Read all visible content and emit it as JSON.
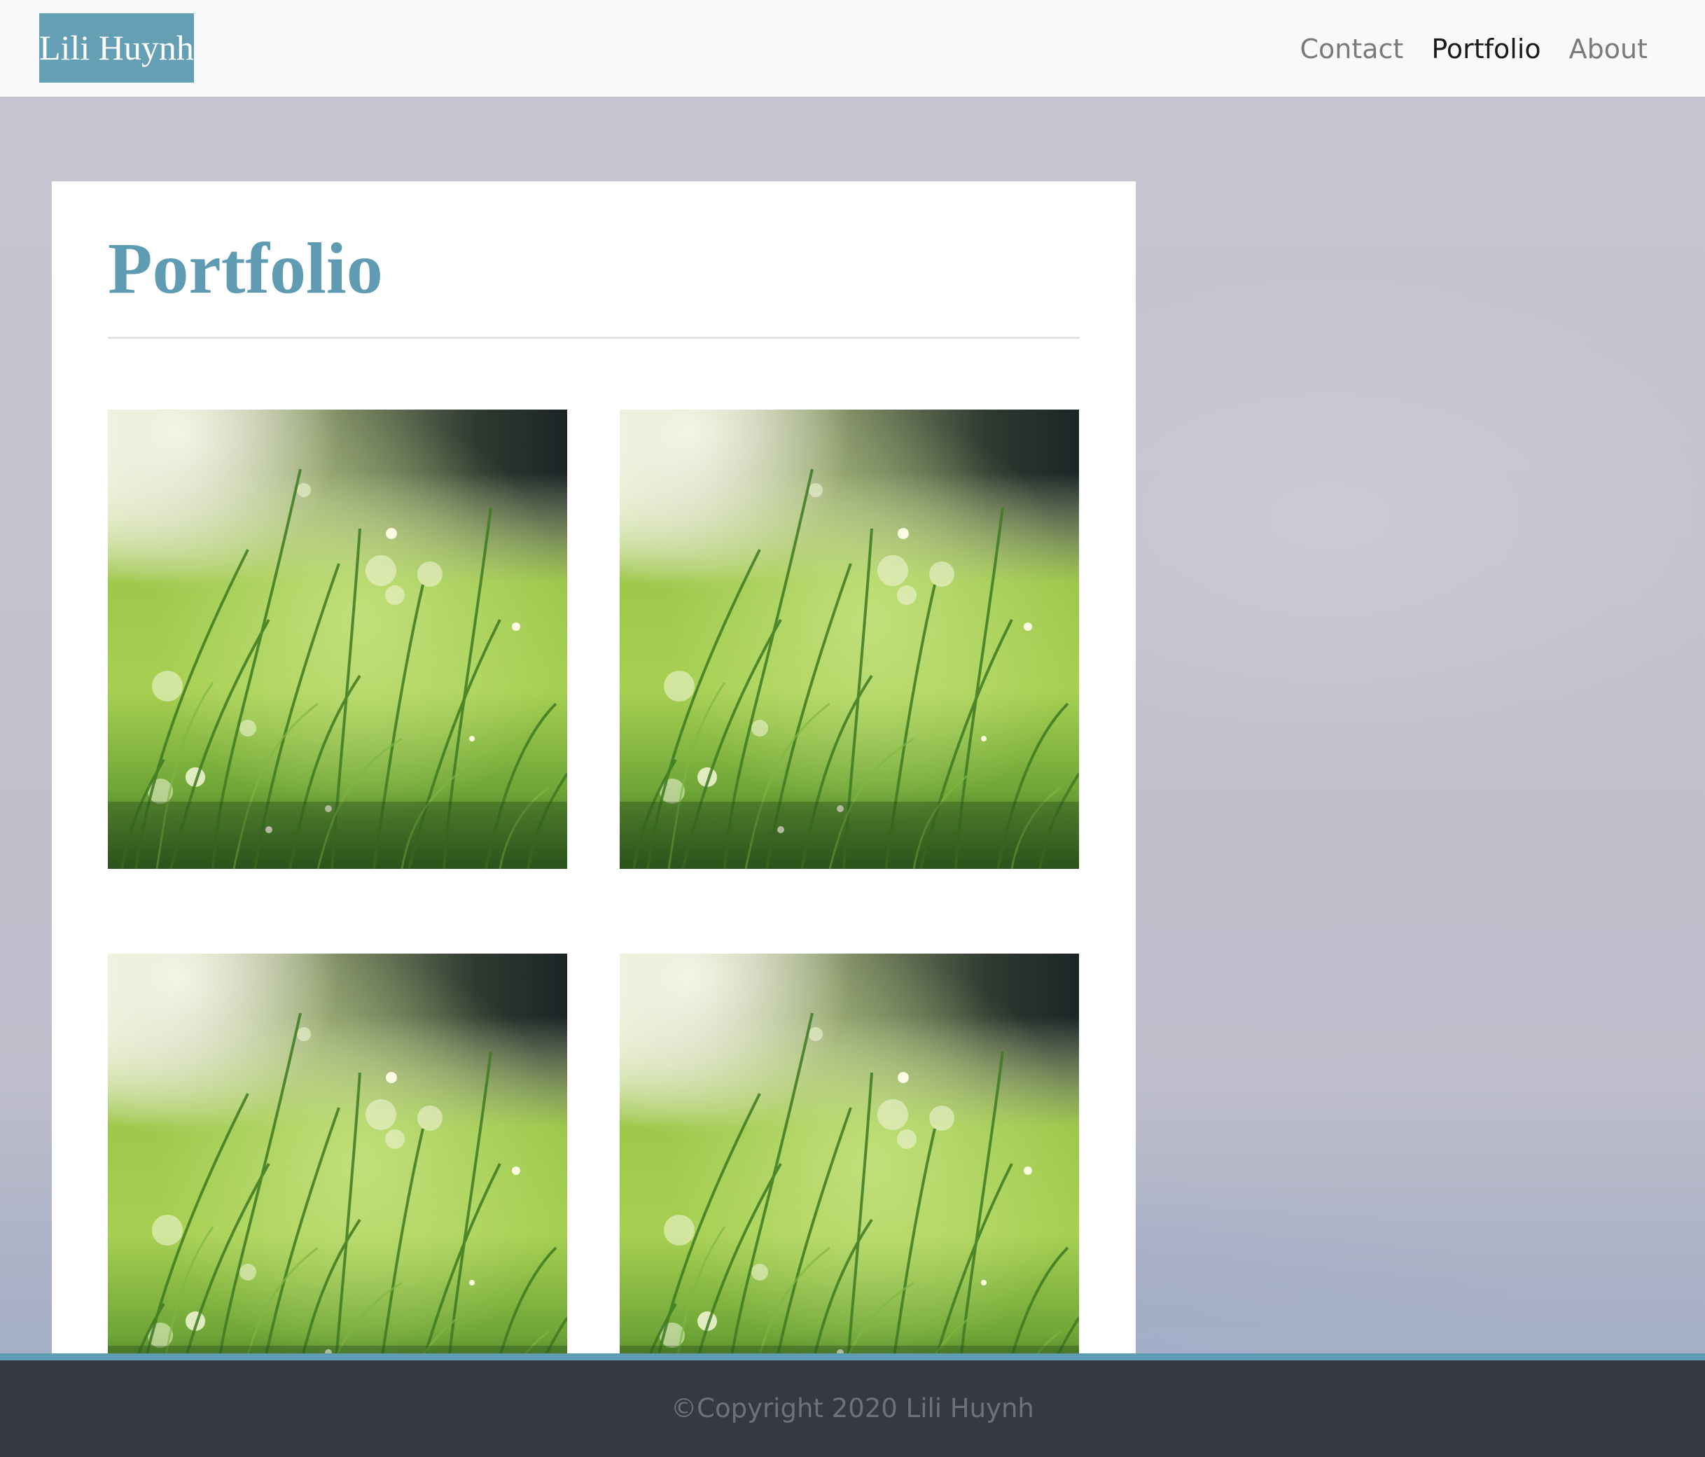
{
  "navbar": {
    "brand": "Lili Huynh",
    "links": [
      {
        "label": "Contact",
        "active": false
      },
      {
        "label": "Portfolio",
        "active": true
      },
      {
        "label": "About",
        "active": false
      }
    ]
  },
  "main": {
    "title": "Portfolio",
    "gallery": [
      {
        "image": "dewy-grass-photo"
      },
      {
        "image": "dewy-grass-photo"
      },
      {
        "image": "dewy-grass-photo"
      },
      {
        "image": "dewy-grass-photo"
      }
    ]
  },
  "footer": {
    "copyright": "©Copyright 2020 Lili Huynh"
  },
  "colors": {
    "accent": "#5f9bb2",
    "brand_bg": "#659fb4",
    "navbar_bg": "#f8f9fa",
    "footer_bg": "#363942",
    "footer_text": "#6d717b"
  }
}
